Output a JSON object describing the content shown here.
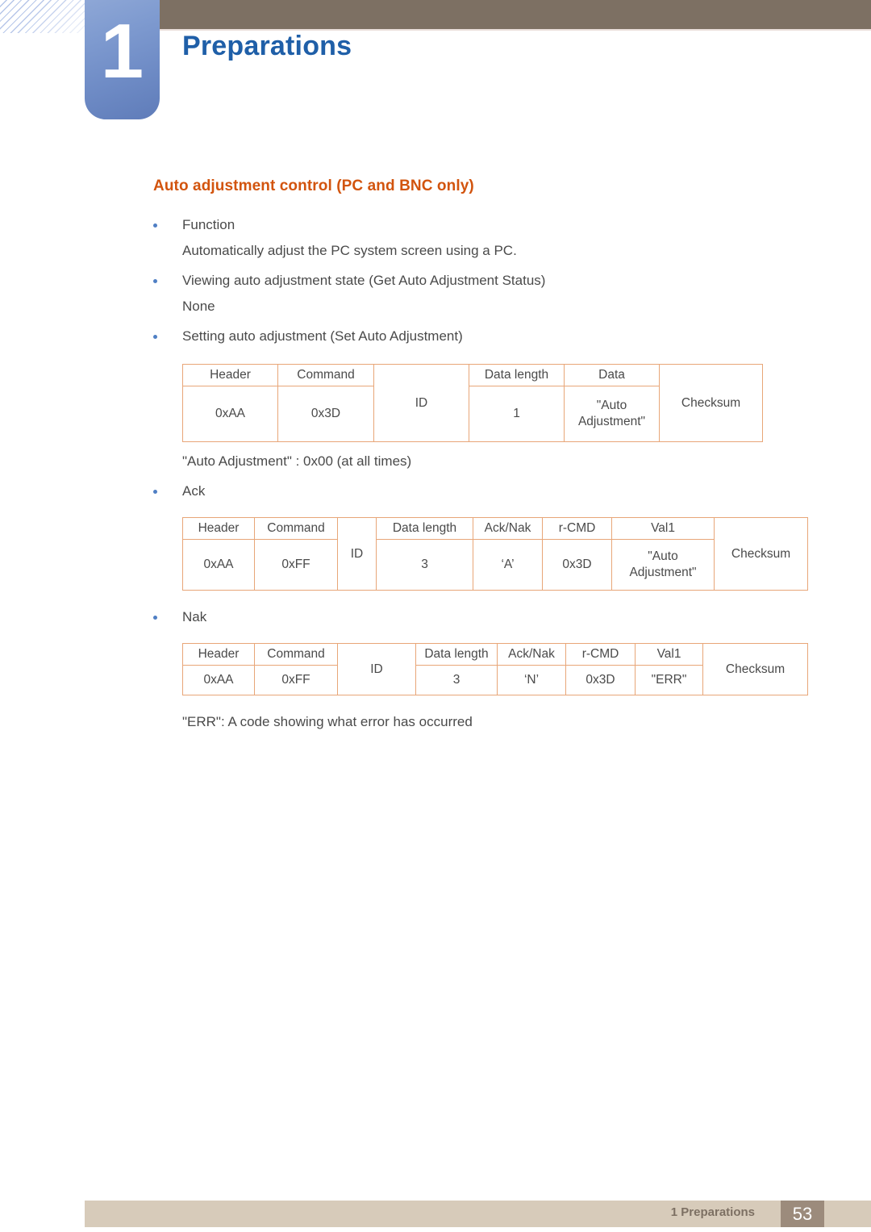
{
  "header": {
    "chapter_number": "1",
    "chapter_title": "Preparations",
    "bar_color": "#7d7063",
    "badge_color": "#6f8cc6",
    "title_color": "#1f5fa8"
  },
  "section": {
    "heading": "Auto adjustment control (PC and BNC only)",
    "heading_color": "#d2540e"
  },
  "body": {
    "bullet_function": "Function",
    "function_description": "Automatically adjust the PC system screen using a PC.",
    "bullet_viewing": "Viewing auto adjustment state (Get Auto Adjustment Status)",
    "viewing_value": "None",
    "bullet_setting": "Setting auto adjustment (Set Auto Adjustment)",
    "note_auto_adjustment": "\"Auto Adjustment\" : 0x00 (at all times)",
    "bullet_ack": "Ack",
    "bullet_nak": "Nak",
    "note_err": "\"ERR\": A code showing what error has occurred"
  },
  "table_set": {
    "headers": [
      "Header",
      "Command",
      "ID",
      "Data length",
      "Data",
      "Checksum"
    ],
    "values": [
      "0xAA",
      "0x3D",
      "ID",
      "1",
      "\"Auto Adjustment\"",
      "Checksum"
    ]
  },
  "table_ack": {
    "headers": [
      "Header",
      "Command",
      "ID",
      "Data length",
      "Ack/Nak",
      "r-CMD",
      "Val1",
      "Checksum"
    ],
    "values": [
      "0xAA",
      "0xFF",
      "ID",
      "3",
      "‘A’",
      "0x3D",
      "\"Auto Adjustment\"",
      "Checksum"
    ]
  },
  "table_nak": {
    "headers": [
      "Header",
      "Command",
      "ID",
      "Data length",
      "Ack/Nak",
      "r-CMD",
      "Val1",
      "Checksum"
    ],
    "values": [
      "0xAA",
      "0xFF",
      "ID",
      "3",
      "‘N’",
      "0x3D",
      "\"ERR\"",
      "Checksum"
    ]
  },
  "footer": {
    "label": "1 Preparations",
    "page_number": "53",
    "bar_color": "#d7cbba",
    "page_box_color": "#9c8b7c"
  }
}
